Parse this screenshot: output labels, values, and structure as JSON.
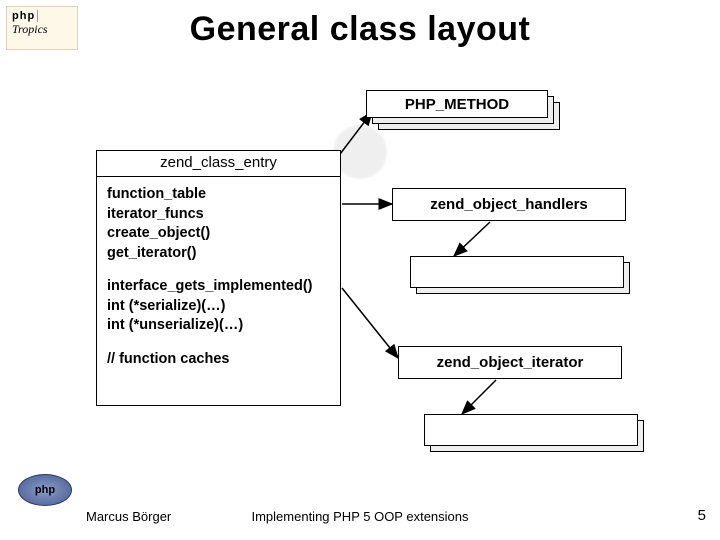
{
  "logo": {
    "line1": "php",
    "line2": "Tropics"
  },
  "title": "General class layout",
  "boxes": {
    "php_method": "PHP_METHOD",
    "zend_class_entry": {
      "header": "zend_class_entry",
      "members": [
        "function_table",
        "iterator_funcs",
        "create_object()",
        "get_iterator()"
      ],
      "members2": [
        "interface_gets_implemented()",
        "int (*serialize)(…)",
        "int (*unserialize)(…)"
      ],
      "members3": [
        "// function caches"
      ]
    },
    "zend_object_handlers": "zend_object_handlers",
    "zend_object_iterator": "zend_object_iterator"
  },
  "footer": {
    "author": "Marcus Börger",
    "subtitle": "Implementing PHP 5 OOP extensions",
    "page": "5",
    "elephant_text": "php"
  }
}
